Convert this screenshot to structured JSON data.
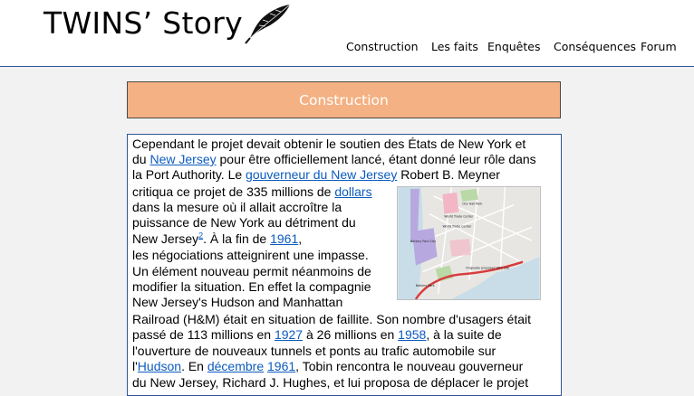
{
  "header": {
    "logo_text": "TWINS’ Story",
    "logo_icon": "feather-icon",
    "nav": [
      "Construction",
      "Les faits",
      "Enquêtes",
      "Conséquences",
      "Forum"
    ]
  },
  "section": {
    "title": "Construction"
  },
  "article": {
    "l1": "Cependant le projet devait obtenir le soutien des États de New York et",
    "l2_a": "du ",
    "l2_link": "New Jersey",
    "l2_b": " pour être officiellement lancé, étant donné leur rôle dans",
    "l3_a": "la Port Authority. Le ",
    "l3_link": "gouverneur du New Jersey",
    "l3_b": " Robert B. Meyner",
    "l4_a": "critiqua ce projet de 335 millions de ",
    "l4_link": "dollars",
    "l5": "dans la mesure où il allait accroître la",
    "l6": "puissance de New York au détriment du",
    "l7_a": "New Jersey",
    "l7_sup": "2",
    "l7_b": ". À la fin de ",
    "l7_link": "1961",
    "l7_c": ",",
    "l8": "les négociations atteignirent une impasse.",
    "l9": " Un élément nouveau permit néanmoins de",
    "l10": " modifier la situation. En effet la compagnie",
    "l11": " New Jersey's Hudson and Manhattan",
    "l12": "Railroad (H&M) était en situation de faillite. Son nombre d'usagers était",
    "l13_a": "passé de 113 millions en ",
    "l13_link1": "1927",
    "l13_b": " à 26 millions en ",
    "l13_link2": "1958",
    "l13_c": ", à la suite de",
    "l14": "l'ouverture de nouveaux tunnels et ponts au trafic automobile sur",
    "l15_a": "l'",
    "l15_link1": "Hudson",
    "l15_b": ". En ",
    "l15_link2": "décembre",
    "l15_c": " ",
    "l15_link3": "1961",
    "l15_d": ", Tobin rencontra le nouveau gouverneur",
    "l16": "du New Jersey, Richard J. Hughes, et lui proposa de déplacer le projet"
  },
  "map": {
    "labels": [
      "World Trade Center",
      "World Trade Center",
      "City Hall Park",
      "Battery Park City",
      "Originally proposed WTC site",
      "Battery Park"
    ],
    "colors": {
      "water": "#c8dde8",
      "land": "#e8e6e3",
      "proposed_area": "#b7a8e0",
      "original_site": "#f2b6c4",
      "park": "#b9d9a6",
      "subway_line": "#d93b3b"
    }
  },
  "colors": {
    "banner": "#f4b183",
    "link": "#0b5bbf",
    "border": "#2f5597",
    "background": "#f2f2f2"
  }
}
